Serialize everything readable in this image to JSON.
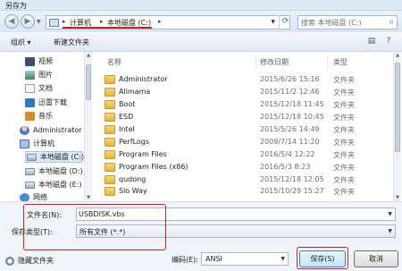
{
  "window": {
    "title": "另存为"
  },
  "address_bar": {
    "segments": [
      "计算机",
      "本地磁盘 (C:)"
    ],
    "search_placeholder": "搜索 本地磁盘 (C:)"
  },
  "toolbar": {
    "organize": "组织 ▾",
    "new_folder": "新建文件夹"
  },
  "nav_pane": {
    "items": [
      {
        "label": "视频",
        "icon": "video-library-icon"
      },
      {
        "label": "图片",
        "icon": "pictures-library-icon"
      },
      {
        "label": "文档",
        "icon": "documents-library-icon"
      },
      {
        "label": "迅雷下载",
        "icon": "download-icon"
      },
      {
        "label": "音乐",
        "icon": "music-library-icon"
      },
      {
        "label": "Administrator",
        "icon": "user-icon"
      },
      {
        "label": "计算机",
        "icon": "computer-icon"
      },
      {
        "label": "本地磁盘 (C:)",
        "icon": "drive-icon",
        "selected": true
      },
      {
        "label": "本地磁盘 (D:)",
        "icon": "drive-icon"
      },
      {
        "label": "本地磁盘 (E:)",
        "icon": "drive-icon"
      },
      {
        "label": "网络",
        "icon": "network-icon"
      }
    ]
  },
  "file_list": {
    "columns": {
      "name": "名称",
      "date": "修改日期",
      "type": "类型"
    },
    "rows": [
      {
        "name": "Administrator",
        "date": "2015/6/26 15:16",
        "type": "文件夹"
      },
      {
        "name": "Alimama",
        "date": "2015/11/2 12:46",
        "type": "文件夹"
      },
      {
        "name": "Boot",
        "date": "2015/12/18 11:45",
        "type": "文件夹"
      },
      {
        "name": "ESD",
        "date": "2015/12/18 10:45",
        "type": "文件夹"
      },
      {
        "name": "Intel",
        "date": "2015/5/26 14:49",
        "type": "文件夹"
      },
      {
        "name": "PerfLogs",
        "date": "2009/7/14 11:20",
        "type": "文件夹"
      },
      {
        "name": "Program Files",
        "date": "2016/5/4 12:22",
        "type": "文件夹"
      },
      {
        "name": "Program Files (x86)",
        "date": "2016/5/3 8:23",
        "type": "文件夹"
      },
      {
        "name": "qudong",
        "date": "2015/12/18 12:05",
        "type": "文件夹"
      },
      {
        "name": "Slo Way",
        "date": "2015/10/29 15:27",
        "type": "文件夹"
      }
    ]
  },
  "save_form": {
    "filename_label": "文件名(N):",
    "filename_value": "USBDISK.vbs",
    "filetype_label": "保存类型(T):",
    "filetype_value": "所有文件  (*.*)",
    "hide_folders": "隐藏文件夹",
    "encoding_label": "编码(E):",
    "encoding_value": "ANSI",
    "save_button": "保存(S)",
    "cancel_button": "取消"
  },
  "colors": {
    "highlight": "#e0191b",
    "accent": "#3c7fb1"
  }
}
